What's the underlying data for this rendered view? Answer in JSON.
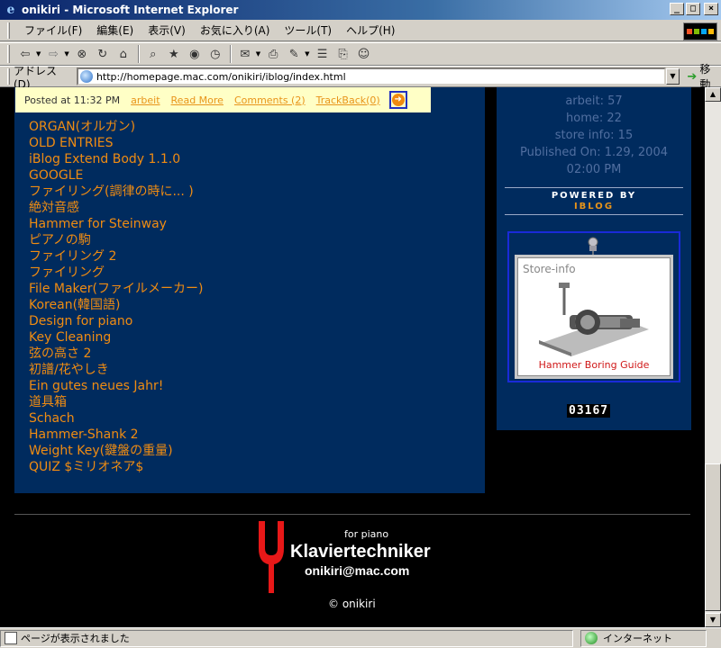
{
  "window": {
    "title": "onikiri - Microsoft Internet Explorer",
    "controls": [
      "_",
      "□",
      "×"
    ]
  },
  "menu": [
    "ファイル(F)",
    "編集(E)",
    "表示(V)",
    "お気に入り(A)",
    "ツール(T)",
    "ヘルプ(H)"
  ],
  "address": {
    "label": "アドレス(D)",
    "url": "http://homepage.mac.com/onikiri/iblog/index.html",
    "go_label": "移動"
  },
  "post_footer": {
    "posted": "Posted at 11:32 PM",
    "category": "arbeit",
    "read_more": "Read More",
    "comments": "Comments (2)",
    "trackback": "TrackBack(0)"
  },
  "entries": [
    "ORGAN(オルガン)",
    "OLD ENTRIES",
    "iBlog Extend Body 1.1.0",
    "GOOGLE",
    "ファイリング(調律の時に... )",
    "絶対音感",
    "Hammer for Steinway",
    "ピアノの駒",
    "ファイリング 2",
    "ファイリング",
    "File Maker(ファイルメーカー)",
    "Korean(韓国語)",
    "Design for piano",
    "Key Cleaning",
    "弦の高さ 2",
    "初譜/花やしき",
    "Ein gutes neues Jahr!",
    "道具箱",
    "Schach",
    "Hammer-Shank 2",
    "Weight Key(鍵盤の重量)",
    "QUIZ $ミリオネア$"
  ],
  "sidebar": {
    "stats": [
      "arbeit: 57",
      "home: 22",
      "store info: 15",
      "Published On: 1.29, 2004",
      "02:00 PM"
    ],
    "powered_by": "POWERED BY",
    "iblog": "IBLOG",
    "store_title": "Store-info",
    "store_caption": "Hammer Boring Guide",
    "counter": "03167"
  },
  "footer": {
    "for_piano": "for piano",
    "brand": "Klaviertechniker",
    "email": "onikiri@mac.com",
    "copyright": "© onikiri"
  },
  "status": {
    "left": "ページが表示されました",
    "zone": "インターネット"
  },
  "colors": {
    "panel_blue": "#002b5e",
    "link_orange": "#f08c12",
    "post_footer_bg": "#ffffc6"
  }
}
